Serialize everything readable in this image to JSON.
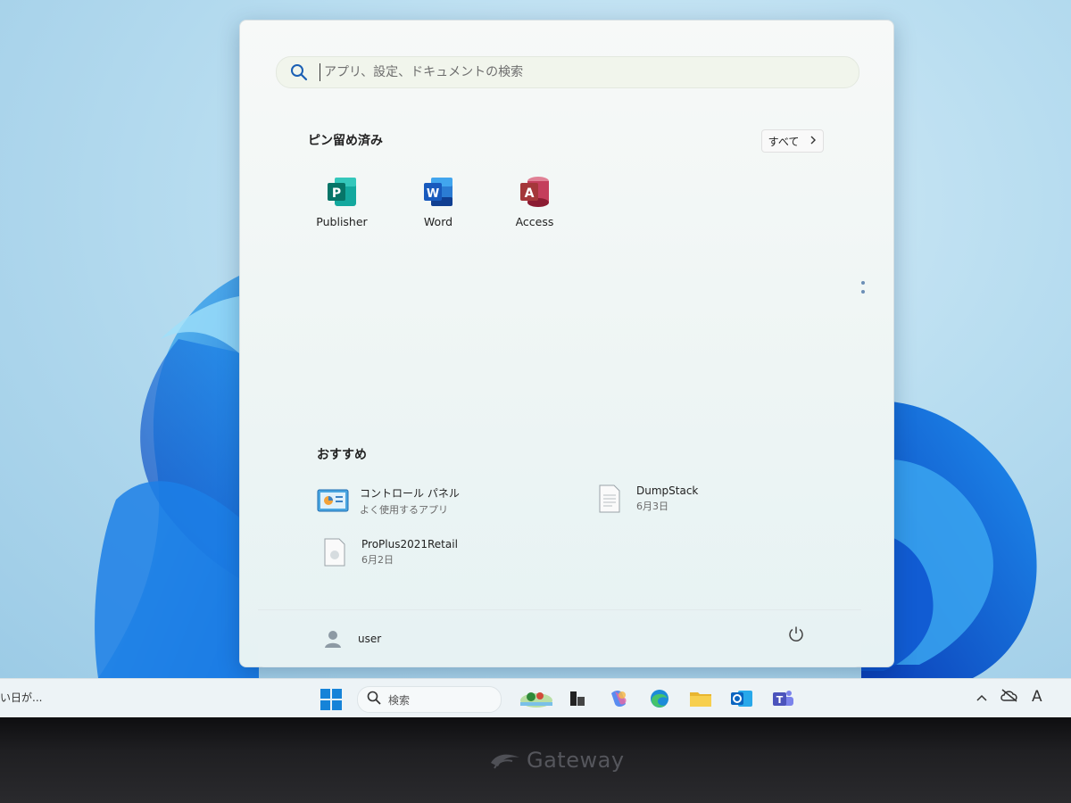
{
  "search": {
    "placeholder": "アプリ、設定、ドキュメントの検索"
  },
  "pinned": {
    "title": "ピン留め済み",
    "all_label": "すべて",
    "apps": [
      {
        "label": "Publisher",
        "icon": "publisher-icon",
        "color": "#077568"
      },
      {
        "label": "Word",
        "icon": "word-icon",
        "color": "#185abd"
      },
      {
        "label": "Access",
        "icon": "access-icon",
        "color": "#a4373a"
      }
    ]
  },
  "recommended": {
    "title": "おすすめ",
    "items": [
      {
        "name": "コントロール パネル",
        "sub": "よく使用するアプリ",
        "icon": "control-panel-icon"
      },
      {
        "name": "DumpStack",
        "sub": "6月3日",
        "icon": "text-file-icon"
      },
      {
        "name": "ProPlus2021Retail",
        "sub": "6月2日",
        "icon": "file-icon"
      }
    ]
  },
  "footer": {
    "user_name": "user"
  },
  "taskbar": {
    "weather_text": "い日が...",
    "search_label": "検索",
    "tray_ime": "A"
  },
  "bezel": {
    "brand": "Gateway"
  },
  "colors": {
    "accent": "#0067c0",
    "wallpaper": "#1a73e8"
  }
}
